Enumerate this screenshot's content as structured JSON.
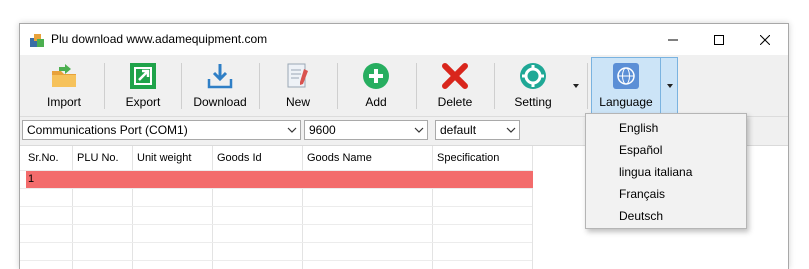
{
  "window": {
    "title": "Plu download www.adamequipment.com",
    "controls": {
      "minimize": "minimize-icon",
      "maximize": "maximize-icon",
      "close": "close-icon"
    }
  },
  "toolbar": {
    "buttons": [
      {
        "label": "Import",
        "icon": "folder-import-icon"
      },
      {
        "label": "Export",
        "icon": "export-icon"
      },
      {
        "label": "Download",
        "icon": "download-icon"
      },
      {
        "label": "New",
        "icon": "new-document-icon"
      },
      {
        "label": "Add",
        "icon": "add-icon"
      },
      {
        "label": "Delete",
        "icon": "delete-icon"
      },
      {
        "label": "Setting",
        "icon": "gear-icon"
      },
      {
        "label": "Language",
        "icon": "globe-icon"
      }
    ]
  },
  "options": {
    "port": "Communications Port (COM1)",
    "baud": "9600",
    "profile": "default"
  },
  "table": {
    "columns": [
      "Sr.No.",
      "PLU No.",
      "Unit weight",
      "Goods Id",
      "Goods Name",
      "Specification"
    ],
    "rows": [
      [
        "1",
        "",
        "",
        "",
        "",
        ""
      ]
    ]
  },
  "language_menu": {
    "items": [
      "English",
      "Español",
      "lingua italiana",
      "Français",
      "Deutsch"
    ]
  },
  "colors": {
    "selected_row": "#f36c6c",
    "active_button": "#cce4f7",
    "accent_green": "#27ae60"
  }
}
